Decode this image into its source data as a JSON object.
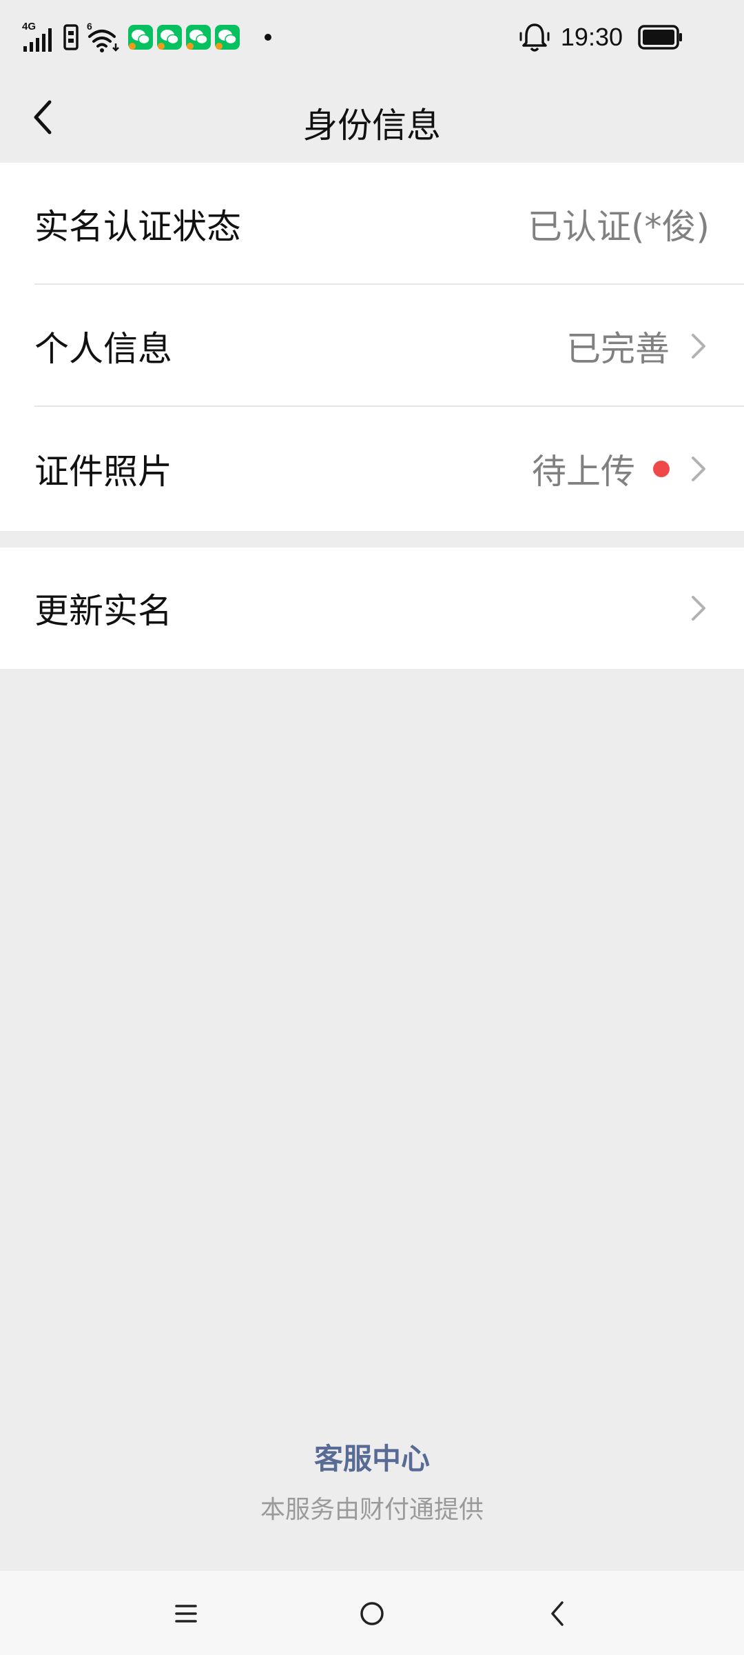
{
  "status_bar": {
    "network": "4G",
    "wifi_badge": "6",
    "time": "19:30",
    "icons": [
      "signal-icon",
      "sim-icon",
      "wifi-icon",
      "wechat-icon",
      "wechat-icon",
      "wechat-icon",
      "wechat-icon",
      "notification-dot",
      "alarm-bell-icon",
      "battery-icon"
    ]
  },
  "nav": {
    "title": "身份信息",
    "back_icon": "chevron-left-icon"
  },
  "rows": [
    {
      "label": "实名认证状态",
      "value": "已认证(*俊)",
      "has_chevron": false
    },
    {
      "label": "个人信息",
      "value": "已完善",
      "has_chevron": true
    },
    {
      "label": "证件照片",
      "value": "待上传",
      "has_chevron": true,
      "badge": "red-dot"
    },
    {
      "label": "更新实名",
      "value": "",
      "has_chevron": true
    }
  ],
  "footer": {
    "link": "客服中心",
    "note": "本服务由财付通提供"
  },
  "system_nav": {
    "icons": [
      "menu-icon",
      "home-icon",
      "back-icon"
    ]
  },
  "colors": {
    "background": "#ededed",
    "card": "#ffffff",
    "link": "#576b95",
    "badge_red": "#f04848",
    "secondary_text": "#808080",
    "wechat_green": "#07c160"
  }
}
